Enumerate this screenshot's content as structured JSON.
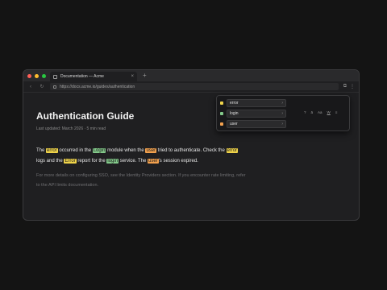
{
  "colors": {
    "dot_red": "#ff5f57",
    "dot_yellow": "#febc2e",
    "dot_green": "#28c840",
    "term_error": "#f0d44a",
    "term_login": "#83c98a",
    "term_user": "#f2a14e"
  },
  "tab": {
    "title": "Documentation — Acme",
    "close_glyph": "×",
    "new_tab_glyph": "+"
  },
  "toolbar": {
    "back_glyph": "‹",
    "reload_glyph": "↻",
    "url": "https://docs.acme.io/guides/authentication",
    "ext_glyph": "⧉",
    "menu_glyph": "⋮"
  },
  "article": {
    "title": "Authentication Guide",
    "meta": "Last updated: March 2026 · 5 min read",
    "p1": {
      "s1": "The ",
      "m1": "error",
      "s2": " occurred in the ",
      "m2": "Login",
      "s3": " module when the ",
      "m3": "user",
      "s4": " tried to authenticate. Check the ",
      "m4": "error",
      "s5": " logs and the ",
      "m5": "Error",
      "s6": " report for the ",
      "m6": "login",
      "s7": " service. The ",
      "m7": "user",
      "s8": "'s session expired."
    },
    "p2": "For more details on configuring SSO, see the Identity Providers section. If you encounter rate limiting, refer to the API limits documentation."
  },
  "find_panel": {
    "terms": [
      {
        "value": "error",
        "color": "#f0d44a"
      },
      {
        "value": "login",
        "color": "#83c98a"
      },
      {
        "value": "user",
        "color": "#f2a14e"
      }
    ],
    "chevron_glyph": "›",
    "options": [
      "?",
      "ä",
      "Aa",
      "W",
      "≡"
    ]
  }
}
